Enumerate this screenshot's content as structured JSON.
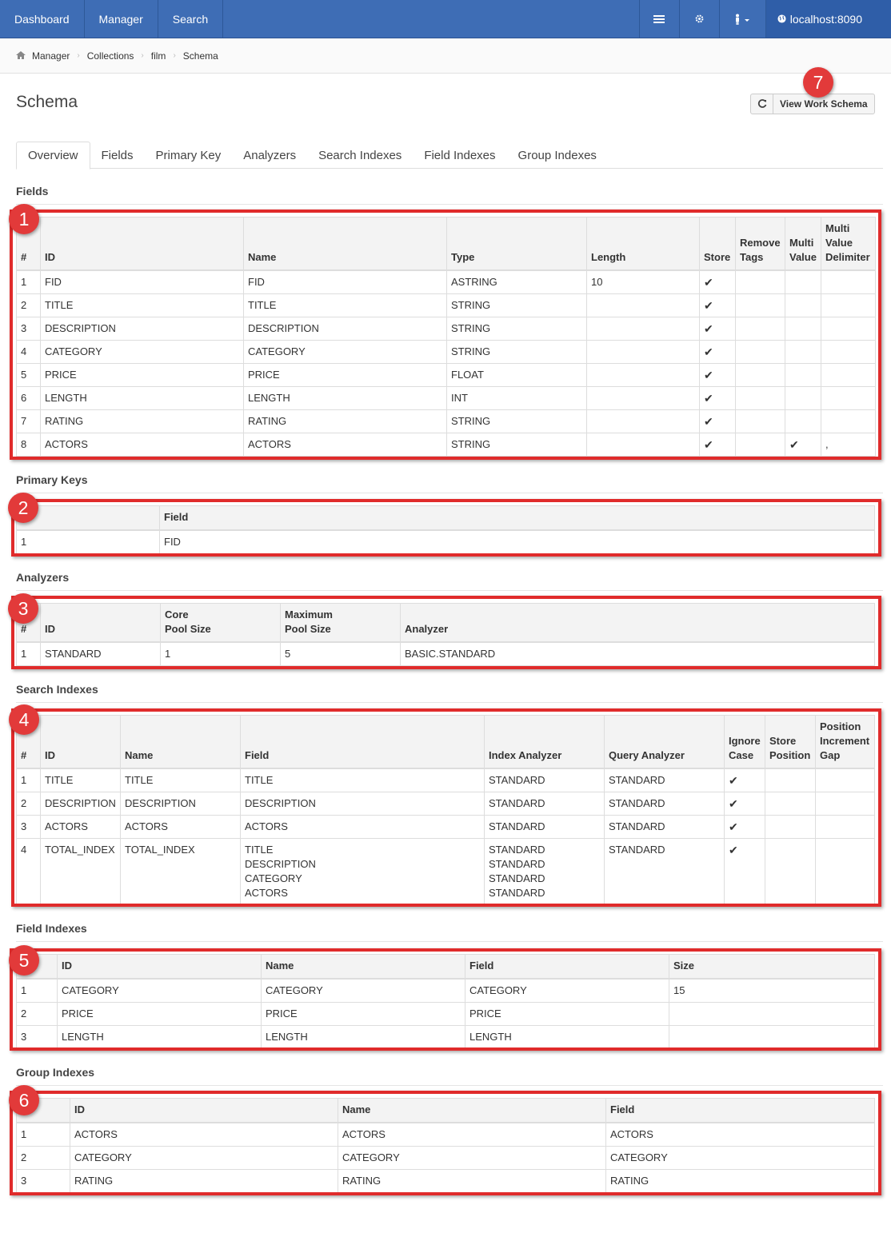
{
  "nav": {
    "items": [
      "Dashboard",
      "Manager",
      "Search"
    ],
    "host": "localhost:8090"
  },
  "breadcrumb": [
    "Manager",
    "Collections",
    "film",
    "Schema"
  ],
  "page": {
    "title": "Schema",
    "view_button": "View Work Schema"
  },
  "tabs": [
    "Overview",
    "Fields",
    "Primary Key",
    "Analyzers",
    "Search Indexes",
    "Field Indexes",
    "Group Indexes"
  ],
  "badges": [
    "1",
    "2",
    "3",
    "4",
    "5",
    "6",
    "7"
  ],
  "fields": {
    "title": "Fields",
    "headers": [
      "#",
      "ID",
      "Name",
      "Type",
      "Length",
      "Store",
      "Remove\nTags",
      "Multi\nValue",
      "Multi\nValue\nDelimiter"
    ],
    "rows": [
      [
        "1",
        "FID",
        "FID",
        "ASTRING",
        "10",
        "✔",
        "",
        "",
        ""
      ],
      [
        "2",
        "TITLE",
        "TITLE",
        "STRING",
        "",
        "✔",
        "",
        "",
        ""
      ],
      [
        "3",
        "DESCRIPTION",
        "DESCRIPTION",
        "STRING",
        "",
        "✔",
        "",
        "",
        ""
      ],
      [
        "4",
        "CATEGORY",
        "CATEGORY",
        "STRING",
        "",
        "✔",
        "",
        "",
        ""
      ],
      [
        "5",
        "PRICE",
        "PRICE",
        "FLOAT",
        "",
        "✔",
        "",
        "",
        ""
      ],
      [
        "6",
        "LENGTH",
        "LENGTH",
        "INT",
        "",
        "✔",
        "",
        "",
        ""
      ],
      [
        "7",
        "RATING",
        "RATING",
        "STRING",
        "",
        "✔",
        "",
        "",
        ""
      ],
      [
        "8",
        "ACTORS",
        "ACTORS",
        "STRING",
        "",
        "✔",
        "",
        "✔",
        ","
      ]
    ]
  },
  "primary_keys": {
    "title": "Primary Keys",
    "headers": [
      "",
      "Field"
    ],
    "rows": [
      [
        "1",
        "FID"
      ]
    ]
  },
  "analyzers": {
    "title": "Analyzers",
    "headers": [
      "#",
      "ID",
      "Core\nPool Size",
      "Maximum\nPool Size",
      "Analyzer"
    ],
    "rows": [
      [
        "1",
        "STANDARD",
        "1",
        "5",
        "BASIC.STANDARD"
      ]
    ]
  },
  "search_indexes": {
    "title": "Search Indexes",
    "headers": [
      "#",
      "ID",
      "Name",
      "Field",
      "Index Analyzer",
      "Query Analyzer",
      "Ignore\nCase",
      "Store\nPosition",
      "Position\nIncrement\nGap"
    ],
    "rows": [
      [
        "1",
        "TITLE",
        "TITLE",
        "TITLE",
        "STANDARD",
        "STANDARD",
        "✔",
        "",
        ""
      ],
      [
        "2",
        "DESCRIPTION",
        "DESCRIPTION",
        "DESCRIPTION",
        "STANDARD",
        "STANDARD",
        "✔",
        "",
        ""
      ],
      [
        "3",
        "ACTORS",
        "ACTORS",
        "ACTORS",
        "STANDARD",
        "STANDARD",
        "✔",
        "",
        ""
      ],
      [
        "4",
        "TOTAL_INDEX",
        "TOTAL_INDEX",
        "TITLE\nDESCRIPTION\nCATEGORY\nACTORS",
        "STANDARD\nSTANDARD\nSTANDARD\nSTANDARD",
        "STANDARD",
        "✔",
        "",
        ""
      ]
    ]
  },
  "field_indexes": {
    "title": "Field Indexes",
    "headers": [
      "",
      "ID",
      "Name",
      "Field",
      "Size"
    ],
    "rows": [
      [
        "1",
        "CATEGORY",
        "CATEGORY",
        "CATEGORY",
        "15"
      ],
      [
        "2",
        "PRICE",
        "PRICE",
        "PRICE",
        ""
      ],
      [
        "3",
        "LENGTH",
        "LENGTH",
        "LENGTH",
        ""
      ]
    ]
  },
  "group_indexes": {
    "title": "Group Indexes",
    "headers": [
      "",
      "ID",
      "Name",
      "Field"
    ],
    "rows": [
      [
        "1",
        "ACTORS",
        "ACTORS",
        "ACTORS"
      ],
      [
        "2",
        "CATEGORY",
        "CATEGORY",
        "CATEGORY"
      ],
      [
        "3",
        "RATING",
        "RATING",
        "RATING"
      ]
    ]
  }
}
